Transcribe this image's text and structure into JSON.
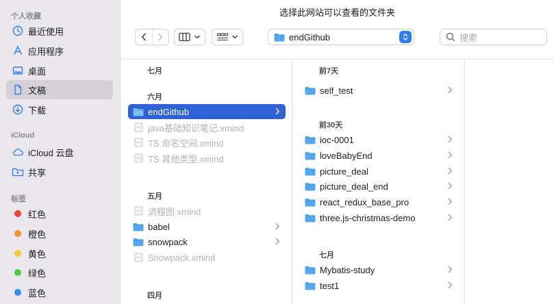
{
  "window": {
    "title": "选择此网站可以查看的文件夹"
  },
  "sidebar": {
    "favorites_header": "个人收藏",
    "favorites": [
      {
        "label": "最近使用",
        "icon": "clock-icon"
      },
      {
        "label": "应用程序",
        "icon": "applications-icon"
      },
      {
        "label": "桌面",
        "icon": "desktop-icon"
      },
      {
        "label": "文稿",
        "icon": "document-icon",
        "selected": true
      },
      {
        "label": "下载",
        "icon": "download-icon"
      }
    ],
    "icloud_header": "iCloud",
    "icloud": [
      {
        "label": "iCloud 云盘",
        "icon": "cloud-icon"
      },
      {
        "label": "共享",
        "icon": "shared-folder-icon"
      }
    ],
    "tags_header": "标签",
    "tags": [
      {
        "label": "红色",
        "color": "#f0443a"
      },
      {
        "label": "橙色",
        "color": "#f39434"
      },
      {
        "label": "黄色",
        "color": "#f5c83a"
      },
      {
        "label": "绿色",
        "color": "#4fc749"
      },
      {
        "label": "蓝色",
        "color": "#3a8cf5"
      }
    ]
  },
  "toolbar": {
    "location": "endGithub",
    "search_placeholder": "搜索"
  },
  "column1": {
    "groups": [
      {
        "label": "七月",
        "items": []
      },
      {
        "label": "六月",
        "items": [
          {
            "label": "endGithub",
            "type": "folder",
            "selected": true
          },
          {
            "label": "java基础知识笔记.xmind",
            "type": "file",
            "disabled": true
          },
          {
            "label": "TS 命名空间.xmind",
            "type": "file",
            "disabled": true
          },
          {
            "label": "TS 其他类型.xmind",
            "type": "file",
            "disabled": true
          }
        ]
      },
      {
        "label": "五月",
        "items": [
          {
            "label": "流程图.xmind",
            "type": "file",
            "disabled": true
          },
          {
            "label": "babel",
            "type": "folder"
          },
          {
            "label": "snowpack",
            "type": "folder"
          },
          {
            "label": "Snowpack.xmind",
            "type": "file",
            "disabled": true
          }
        ]
      },
      {
        "label": "四月",
        "items": []
      }
    ]
  },
  "column2": {
    "groups": [
      {
        "label": "前7天",
        "items": [
          {
            "label": "self_test"
          }
        ]
      },
      {
        "label": "前30天",
        "items": [
          {
            "label": "ioc-0001"
          },
          {
            "label": "loveBabyEnd"
          },
          {
            "label": "picture_deal"
          },
          {
            "label": "picture_deal_end"
          },
          {
            "label": "react_redux_base_pro"
          },
          {
            "label": "three.js-christmas-demo"
          }
        ]
      },
      {
        "label": "七月",
        "items": [
          {
            "label": "Mybatis-study"
          },
          {
            "label": "test1"
          }
        ]
      }
    ]
  },
  "colors": {
    "accent": "#2f62d6",
    "folder": "#55a8ef",
    "sidebar_icon": "#2f7ef5"
  }
}
